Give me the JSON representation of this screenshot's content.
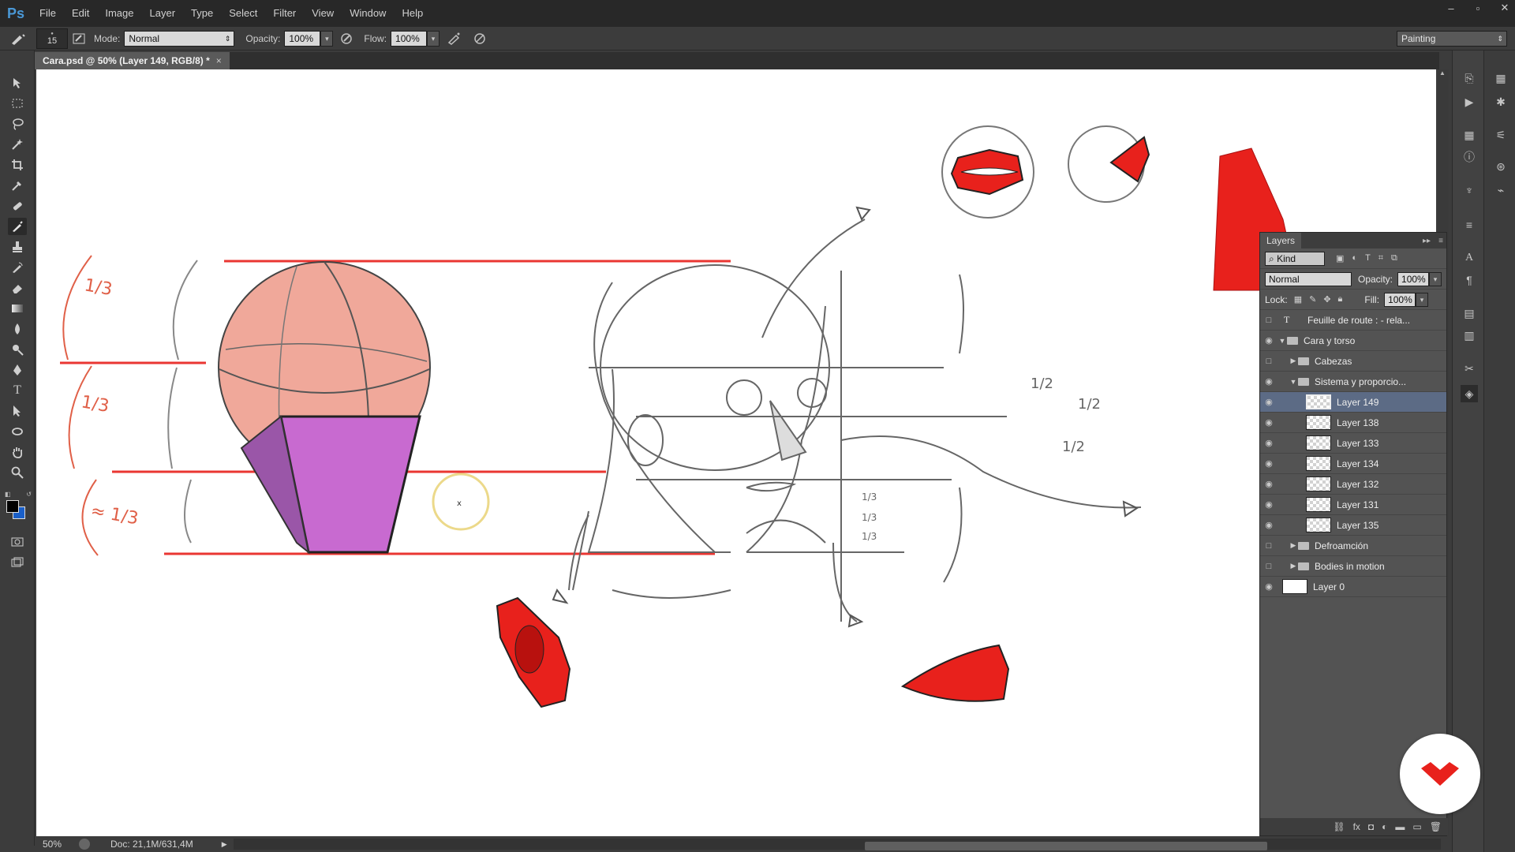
{
  "app": {
    "logo": "Ps"
  },
  "menu": [
    "File",
    "Edit",
    "Image",
    "Layer",
    "Type",
    "Select",
    "Filter",
    "View",
    "Window",
    "Help"
  ],
  "window_controls": {
    "minimize": "–",
    "restore": "▫",
    "close": "✕"
  },
  "options": {
    "brush_size": "15",
    "mode_label": "Mode:",
    "mode_value": "Normal",
    "opacity_label": "Opacity:",
    "opacity_value": "100%",
    "flow_label": "Flow:",
    "flow_value": "100%",
    "workspace": "Painting"
  },
  "document": {
    "tab_title": "Cara.psd @ 50% (Layer 149, RGB/8) *",
    "close": "×"
  },
  "status": {
    "zoom": "50%",
    "doc": "Doc: 21,1M/631,4M"
  },
  "canvas_notes": {
    "t1": "1/3",
    "t2": "1/3",
    "t3": "≈ 1/3",
    "h1": "1/2",
    "h2": "1/2",
    "h3": "1/2",
    "q1": "1/3",
    "q2": "1/3",
    "q3": "1/3"
  },
  "layers_panel": {
    "title": "Layers",
    "kind_label": "Kind",
    "blend_mode": "Normal",
    "opacity_label": "Opacity:",
    "opacity_value": "100%",
    "lock_label": "Lock:",
    "fill_label": "Fill:",
    "fill_value": "100%",
    "layers": [
      {
        "name": "Feuille de route : - rela...",
        "type": "text"
      },
      {
        "name": "Cara y torso",
        "type": "group"
      },
      {
        "name": "Cabezas",
        "type": "group"
      },
      {
        "name": "Sistema y proporcio...",
        "type": "group"
      },
      {
        "name": "Layer 149",
        "type": "layer",
        "selected": true
      },
      {
        "name": "Layer 138",
        "type": "layer"
      },
      {
        "name": "Layer 133",
        "type": "layer"
      },
      {
        "name": "Layer 134",
        "type": "layer"
      },
      {
        "name": "Layer 132",
        "type": "layer"
      },
      {
        "name": "Layer 131",
        "type": "layer"
      },
      {
        "name": "Layer 135",
        "type": "layer"
      },
      {
        "name": "Defroamción",
        "type": "group"
      },
      {
        "name": "Bodies in motion",
        "type": "group"
      },
      {
        "name": "Layer 0",
        "type": "background"
      }
    ]
  },
  "colors": {
    "foreground": "#000000",
    "background": "#1a5fc8",
    "accent_red": "#e8211c",
    "selection": "#5c6b85"
  }
}
